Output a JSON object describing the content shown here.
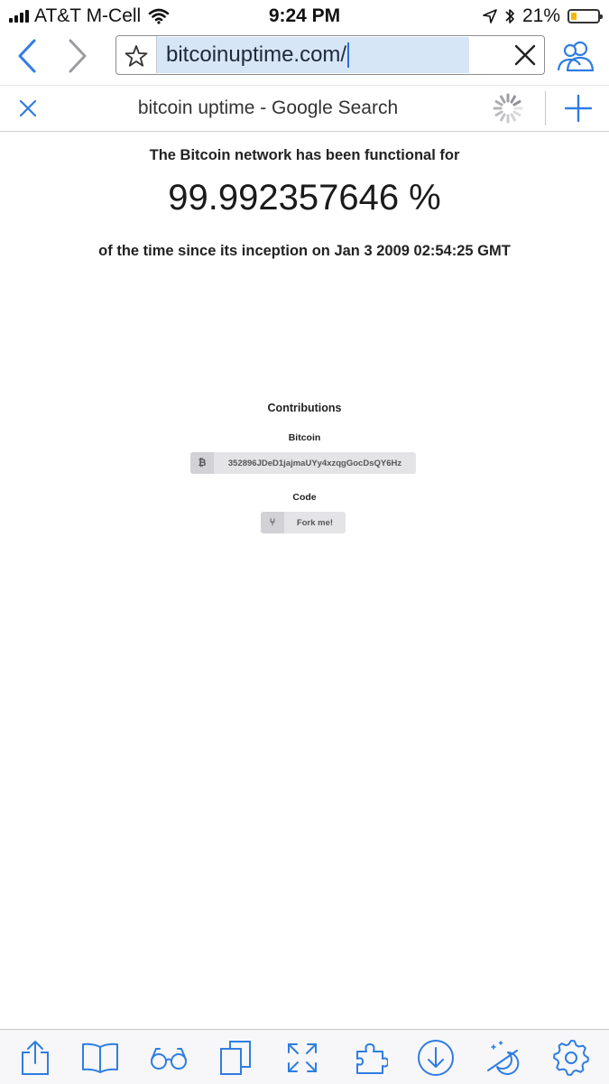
{
  "status_bar": {
    "carrier": "AT&T M-Cell",
    "time": "9:24 PM",
    "battery_percent": "21%",
    "battery_level": 0.21,
    "icons": [
      "signal-icon",
      "wifi-icon",
      "location-icon",
      "bluetooth-icon",
      "battery-icon"
    ]
  },
  "address_bar": {
    "url": "bitcoinuptime.com/",
    "icons": [
      "back-icon",
      "forward-icon",
      "bookmark-star-icon",
      "clear-icon",
      "people-icon"
    ]
  },
  "tab_bar": {
    "title": "bitcoin uptime - Google Search",
    "loading": true,
    "icons": [
      "close-tab-icon",
      "loading-spinner-icon",
      "new-tab-icon"
    ]
  },
  "page": {
    "headline": "The Bitcoin network has been functional for",
    "uptime_percent": "99.992357646 %",
    "since_text": "of the time since its inception on Jan 3 2009 02:54:25 GMT",
    "contributions": {
      "title": "Contributions",
      "bitcoin_label": "Bitcoin",
      "bitcoin_icon": "₿",
      "bitcoin_address": "352896JDeD1jajmaUYy4xzqgGocDsQY6Hz",
      "code_label": "Code",
      "fork_icon": "⑂",
      "fork_label": "Fork me!"
    }
  },
  "toolbar": {
    "accent_color": "#2f7de1",
    "items": [
      "share-icon",
      "bookmarks-book-icon",
      "reading-glasses-icon",
      "tabs-copy-icon",
      "fullscreen-icon",
      "addons-puzzle-icon",
      "downloads-icon",
      "night-mode-icon",
      "settings-gear-icon"
    ]
  }
}
